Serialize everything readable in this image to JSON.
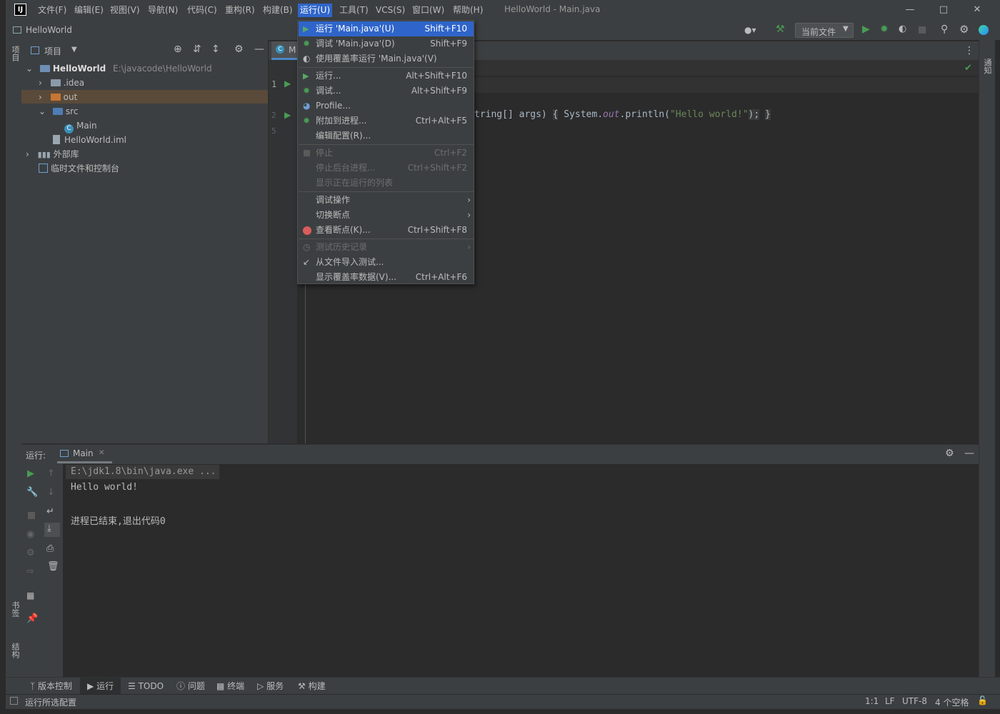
{
  "title_bar": {
    "logo_text": "IJ",
    "menus": [
      "文件(F)",
      "编辑(E)",
      "视图(V)",
      "导航(N)",
      "代码(C)",
      "重构(R)",
      "构建(B)",
      "运行(U)",
      "工具(T)",
      "VCS(S)",
      "窗口(W)",
      "帮助(H)"
    ],
    "window_title": "HelloWorld - Main.java"
  },
  "nav_bar": {
    "breadcrumb": "HelloWorld",
    "run_config": "当前文件"
  },
  "left_strip": {
    "project_label": "项目",
    "bookmarks_label": "书签",
    "structure_label": "结构"
  },
  "right_strip": {
    "notifications_label": "通知"
  },
  "project_panel": {
    "header_label": "项目",
    "tree": [
      {
        "label": "HelloWorld",
        "path": "E:\\javacode\\HelloWorld"
      },
      {
        "label": ".idea"
      },
      {
        "label": "out"
      },
      {
        "label": "src"
      },
      {
        "label": "Main"
      },
      {
        "label": "HelloWorld.iml"
      },
      {
        "label": "外部库"
      },
      {
        "label": "临时文件和控制台"
      }
    ]
  },
  "editor": {
    "tab_label": "M",
    "line_numbers": [
      "1",
      "2",
      "5"
    ],
    "code_visible": {
      "part1": "tring[] args) ",
      "brace_open": "{",
      "sys": " System.",
      "out": "out",
      "call": ".println(",
      "str": "\"Hello world!\"",
      "end": ");",
      "brace_close": "}"
    }
  },
  "run_menu": {
    "items": [
      {
        "label": "运行 'Main.java'(U)",
        "shortcut": "Shift+F10"
      },
      {
        "label": "调试 'Main.java'(D)",
        "shortcut": "Shift+F9"
      },
      {
        "label": "使用覆盖率运行 'Main.java'(V)",
        "shortcut": ""
      },
      {
        "label": "运行...",
        "shortcut": "Alt+Shift+F10"
      },
      {
        "label": "调试...",
        "shortcut": "Alt+Shift+F9"
      },
      {
        "label": "Profile...",
        "shortcut": ""
      },
      {
        "label": "附加到进程...",
        "shortcut": "Ctrl+Alt+F5"
      },
      {
        "label": "编辑配置(R)...",
        "shortcut": ""
      },
      {
        "label": "停止",
        "shortcut": "Ctrl+F2"
      },
      {
        "label": "停止后台进程...",
        "shortcut": "Ctrl+Shift+F2"
      },
      {
        "label": "显示正在运行的列表",
        "shortcut": ""
      },
      {
        "label": "调试操作",
        "shortcut": ""
      },
      {
        "label": "切换断点",
        "shortcut": ""
      },
      {
        "label": "查看断点(K)...",
        "shortcut": "Ctrl+Shift+F8"
      },
      {
        "label": "测试历史记录",
        "shortcut": ""
      },
      {
        "label": "从文件导入测试...",
        "shortcut": ""
      },
      {
        "label": "显示覆盖率数据(V)...",
        "shortcut": "Ctrl+Alt+F6"
      }
    ]
  },
  "run_panel": {
    "label": "运行:",
    "tab": "Main",
    "console": [
      "E:\\jdk1.8\\bin\\java.exe ...",
      "Hello world!",
      "",
      "进程已结束,退出代码0"
    ]
  },
  "bottom_tabs": [
    "版本控制",
    "运行",
    "TODO",
    "问题",
    "终端",
    "服务",
    "构建"
  ],
  "status_bar": {
    "message": "运行所选配置",
    "position": "1:1",
    "line_sep": "LF",
    "encoding": "UTF-8",
    "indent": "4 个空格"
  },
  "colors": {
    "accent": "#2f65ca",
    "run_green": "#499c54",
    "folder_blue": "#4f7db4",
    "folder_orange": "#c57633",
    "string_green": "#6a8759"
  }
}
